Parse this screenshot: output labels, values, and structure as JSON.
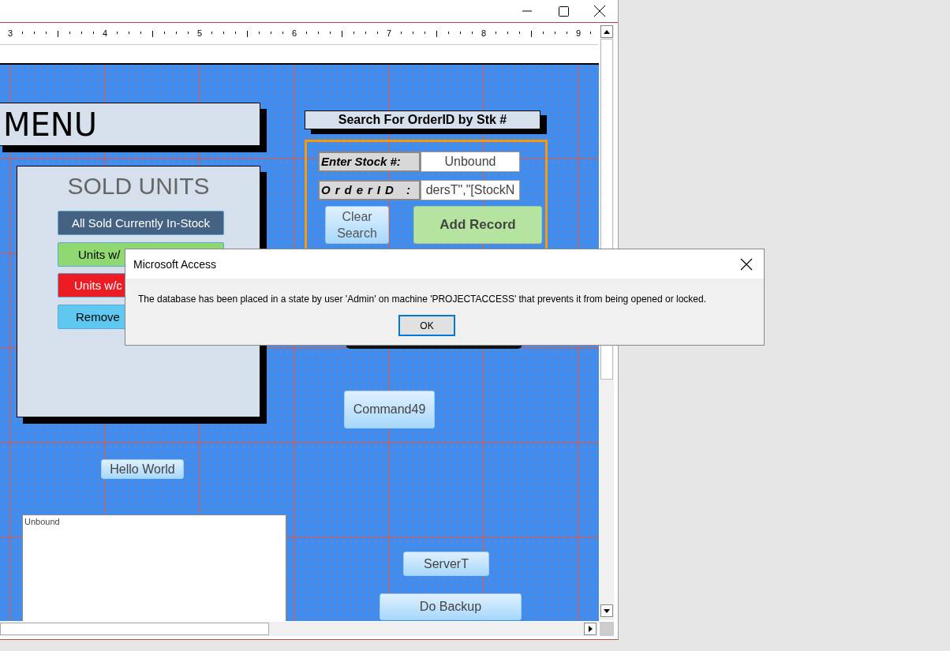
{
  "ruler": {
    "marks": [
      "3",
      "4",
      "5",
      "6",
      "7",
      "8",
      "9"
    ]
  },
  "form": {
    "menu_title": "MENU",
    "sold_units": {
      "title": "SOLD UNITS",
      "buttons": [
        {
          "label": "All Sold Currently In-Stock",
          "color": "#466283"
        },
        {
          "label": "Units w/",
          "color": "#8fd872"
        },
        {
          "label": "Units w/c",
          "color": "#ed1c24"
        },
        {
          "label": "Remove",
          "color": "#5ec8f0"
        }
      ]
    },
    "search": {
      "title": "Search For OrderID by Stk #",
      "fields": [
        {
          "label": "Enter Stock #:",
          "value": "Unbound"
        },
        {
          "label": "OrderID :",
          "value": "dersT\",\"[StockN"
        }
      ],
      "clear_button": "Clear Search",
      "add_button": "Add Record"
    },
    "buttons": [
      "Command49",
      "Hello World",
      "ServerT",
      "Do Backup"
    ],
    "text_box": {
      "value": "Unbound"
    }
  },
  "dialog": {
    "title": "Microsoft Access",
    "message": "The database has been placed in a state by user 'Admin' on machine 'PROJECTACCESS' that prevents it from being opened or locked.",
    "buttons": [
      "OK"
    ]
  }
}
